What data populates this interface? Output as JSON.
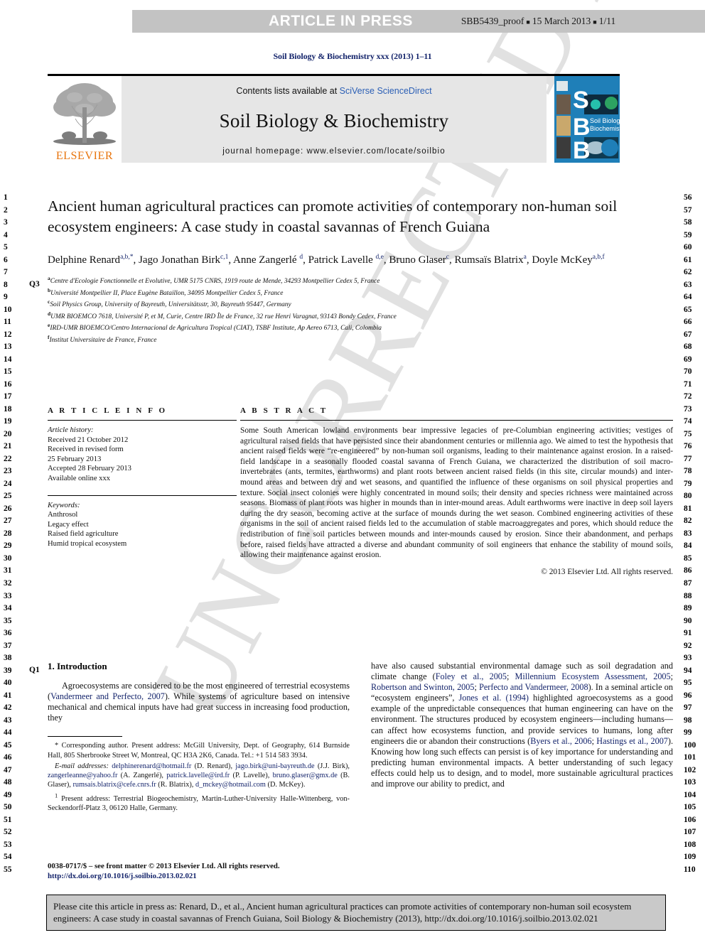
{
  "press_band": {
    "title": "ARTICLE IN PRESS",
    "proof_id": "SBB5439_proof",
    "proof_date": "15 March 2013",
    "proof_page": "1/11",
    "band_color": "#c3c3c3"
  },
  "journal_ref": "Soil Biology & Biochemistry xxx (2013) 1–11",
  "masthead": {
    "contents_prefix": "Contents lists available at ",
    "contents_link": "SciVerse ScienceDirect",
    "journal_name": "Soil Biology & Biochemistry",
    "homepage": "journal homepage: www.elsevier.com/locate/soilbio",
    "publisher_logo_text": "ELSEVIER",
    "publisher_logo_color": "#e8740c",
    "cover_letters": [
      "S",
      "B",
      "B"
    ],
    "cover_caption": "Soil Biology & Biochemistry",
    "cover_color": "#1f7fb8",
    "link_color": "#2b5fb5"
  },
  "article": {
    "title": "Ancient human agricultural practices can promote activities of contemporary non-human soil ecosystem engineers: A case study in coastal savannas of French Guiana",
    "authors_html": "Delphine Renard<sup>a,b,*</sup>, Jago Jonathan Birk<sup>c,1</sup>, Anne Zangerlé <sup>d</sup>, Patrick Lavelle <sup>d,e</sup>, Bruno Glaser<sup>c</sup>, Rumsaïs Blatrix<sup>a</sup>, Doyle McKey<sup>a,b,f</sup>",
    "affiliations": [
      {
        "label": "a",
        "text": "Centre d'Ecologie Fonctionnelle et Evolutive, UMR 5175 CNRS, 1919 route de Mende, 34293 Montpellier Cedex 5, France"
      },
      {
        "label": "b",
        "text": "Université Montpellier II, Place Eugène Bataillon, 34095 Montpellier Cedex 5, France"
      },
      {
        "label": "c",
        "text": "Soil Physics Group, University of Bayreuth, Universitätsstr, 30, Bayreuth 95447, Germany"
      },
      {
        "label": "d",
        "text": "UMR BIOEMCO 7618, Université P, et M, Curie, Centre IRD Île de France, 32 rue Henri Varagnat, 93143 Bondy Cedex, France"
      },
      {
        "label": "e",
        "text": "IRD-UMR BIOEMCO/Centro Internacional de Agricultura Tropical (CIAT), TSBF Institute, Ap Aereo 6713, Cali, Colombia"
      },
      {
        "label": "f",
        "text": "Institut Universitaire de France, France"
      }
    ]
  },
  "article_info": {
    "heading": "A R T I C L E  I N F O",
    "history_label": "Article history:",
    "history": [
      "Received 21 October 2012",
      "Received in revised form",
      "25 February 2013",
      "Accepted 28 February 2013",
      "Available online xxx"
    ],
    "keywords_label": "Keywords:",
    "keywords": [
      "Anthrosol",
      "Legacy effect",
      "Raised field agriculture",
      "Humid tropical ecosystem"
    ]
  },
  "abstract": {
    "heading": "A B S T R A C T",
    "text": "Some South American lowland environments bear impressive legacies of pre-Columbian engineering activities; vestiges of agricultural raised fields that have persisted since their abandonment centuries or millennia ago. We aimed to test the hypothesis that ancient raised fields were “re-engineered” by non-human soil organisms, leading to their maintenance against erosion. In a raised-field landscape in a seasonally flooded coastal savanna of French Guiana, we characterized the distribution of soil macro-invertebrates (ants, termites, earthworms) and plant roots between ancient raised fields (in this site, circular mounds) and inter-mound areas and between dry and wet seasons, and quantified the influence of these organisms on soil physical properties and texture. Social insect colonies were highly concentrated in mound soils; their density and species richness were maintained across seasons. Biomass of plant roots was higher in mounds than in inter-mound areas. Adult earthworms were inactive in deep soil layers during the dry season, becoming active at the surface of mounds during the wet season. Combined engineering activities of these organisms in the soil of ancient raised fields led to the accumulation of stable macroaggregates and pores, which should reduce the redistribution of fine soil particles between mounds and inter-mounds caused by erosion. Since their abandonment, and perhaps before, raised fields have attracted a diverse and abundant community of soil engineers that enhance the stability of mound soils, allowing their maintenance against erosion.",
    "copyright": "© 2013 Elsevier Ltd. All rights reserved."
  },
  "introduction": {
    "q_marker": "Q1",
    "heading": "1.  Introduction",
    "left_para_html": "Agroecosystems are considered to be the most engineered of terrestrial ecosystems (<span class=\"ref\">Vandermeer and Perfecto, 2007</span>). While systems of agriculture based on intensive mechanical and chemical inputs have had great success in increasing food production, they",
    "right_para_html": "have also caused substantial environmental damage such as soil degradation and climate change (<span class=\"ref\">Foley et al., 2005</span>; <span class=\"ref\">Millennium Ecosystem Assessment, 2005</span>; <span class=\"ref\">Robertson and Swinton, 2005</span>; <span class=\"ref\">Perfecto and Vandermeer, 2008</span>). In a seminal article on “ecosystem engineers”, <span class=\"ref\">Jones et al. (1994)</span> highlighted agroecosystems as a good example of the unpredictable consequences that human engineering can have on the environment. The structures produced by ecosystem engineers—including humans—can affect how ecosystems function, and provide services to humans, long after engineers die or abandon their constructions (<span class=\"ref\">Byers et al., 2006</span>; <span class=\"ref\">Hastings et al., 2007</span>). Knowing how long such effects can persist is of key importance for understanding and predicting human environmental impacts. A better understanding of such legacy effects could help us to design, and to model, more sustainable agricultural practices and improve our ability to predict, and"
  },
  "footnotes": {
    "corresponding_html": "<span class=\"lead\">* Corresponding author. Present address: McGill University, Dept. of Geography, 614 Burnside Hall, 805 Sherbrooke Street W, Montreal, QC H3A 2K6, Canada. Tel.: +1 514 583 3934.</span>",
    "emails_html": "<span class=\"lead\"><span class=\"em\">E-mail addresses:</span> <span class=\"mail\">delphinerenard@hotmail.fr</span> (D. Renard), <span class=\"mail\">jago.birk@uni-bayreuth.de</span> (J.J. Birk), <span class=\"mail\">zangerleanne@yahoo.fr</span> (A. Zangerlé), <span class=\"mail\">patrick.lavelle@ird.fr</span> (P. Lavelle), <span class=\"mail\">bruno.glaser@gmx.de</span> (B. Glaser), <span class=\"mail\">rumsais.blatrix@cefe.cnrs.fr</span> (R. Blatrix), <span class=\"mail\">d_mckey@hotmail.com</span> (D. McKey).</span>",
    "present_address_html": "<span class=\"lead\"><sup>1</sup> Present address: Terrestrial Biogeochemistry, Martin-Luther-University Halle-Wittenberg, von-Seckendorff-Platz 3, 06120 Halle, Germany.</span>"
  },
  "footer": {
    "issn_line": "0038-0717/$ – see front matter © 2013 Elsevier Ltd. All rights reserved.",
    "doi_line": "http://dx.doi.org/10.1016/j.soilbio.2013.02.021"
  },
  "citation_box": {
    "text": "Please cite this article in press as: Renard, D., et al., Ancient human agricultural practices can promote activities of contemporary non-human soil ecosystem engineers: A case study in coastal savannas of French Guiana, Soil Biology & Biochemistry (2013), http://dx.doi.org/10.1016/j.soilbio.2013.02.021",
    "background": "#c9c9c9"
  },
  "line_numbers": {
    "left_start": 1,
    "left_end": 55,
    "right_start": 56,
    "right_end": 110
  },
  "markers": {
    "authors_query": "Q3"
  },
  "watermark": "UNCORRECTED PROOF"
}
